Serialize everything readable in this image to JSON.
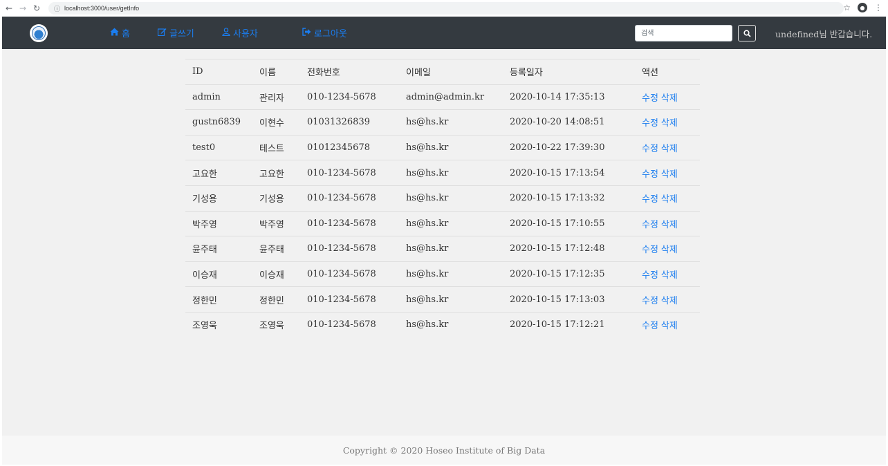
{
  "browser": {
    "url": "localhost:3000/user/getInfo"
  },
  "navbar": {
    "links": [
      {
        "label": "홈",
        "icon": "home-icon"
      },
      {
        "label": "글쓰기",
        "icon": "edit-icon"
      },
      {
        "label": "사용자",
        "icon": "user-icon"
      },
      {
        "label": "로그아웃",
        "icon": "sign-out-icon"
      }
    ],
    "search_placeholder": "검색",
    "greeting": "undefined님 반갑습니다."
  },
  "table": {
    "headers": [
      "ID",
      "이름",
      "전화번호",
      "이메일",
      "등록일자",
      "액션"
    ],
    "edit_label": "수정",
    "delete_label": "삭제",
    "rows": [
      {
        "id": "admin",
        "name": "관리자",
        "phone": "010-1234-5678",
        "email": "admin@admin.kr",
        "date": "2020-10-14 17:35:13"
      },
      {
        "id": "gustn6839",
        "name": "이현수",
        "phone": "01031326839",
        "email": "hs@hs.kr",
        "date": "2020-10-20 14:08:51"
      },
      {
        "id": "test0",
        "name": "테스트",
        "phone": "01012345678",
        "email": "hs@hs.kr",
        "date": "2020-10-22 17:39:30"
      },
      {
        "id": "고요한",
        "name": "고요한",
        "phone": "010-1234-5678",
        "email": "hs@hs.kr",
        "date": "2020-10-15 17:13:54"
      },
      {
        "id": "기성용",
        "name": "기성용",
        "phone": "010-1234-5678",
        "email": "hs@hs.kr",
        "date": "2020-10-15 17:13:32"
      },
      {
        "id": "박주영",
        "name": "박주영",
        "phone": "010-1234-5678",
        "email": "hs@hs.kr",
        "date": "2020-10-15 17:10:55"
      },
      {
        "id": "윤주태",
        "name": "윤주태",
        "phone": "010-1234-5678",
        "email": "hs@hs.kr",
        "date": "2020-10-15 17:12:48"
      },
      {
        "id": "이승재",
        "name": "이승재",
        "phone": "010-1234-5678",
        "email": "hs@hs.kr",
        "date": "2020-10-15 17:12:35"
      },
      {
        "id": "정한민",
        "name": "정한민",
        "phone": "010-1234-5678",
        "email": "hs@hs.kr",
        "date": "2020-10-15 17:13:03"
      },
      {
        "id": "조영욱",
        "name": "조영욱",
        "phone": "010-1234-5678",
        "email": "hs@hs.kr",
        "date": "2020-10-15 17:12:21"
      }
    ]
  },
  "footer": {
    "text": "Copyright © 2020 Hoseo Institute of Big Data"
  }
}
